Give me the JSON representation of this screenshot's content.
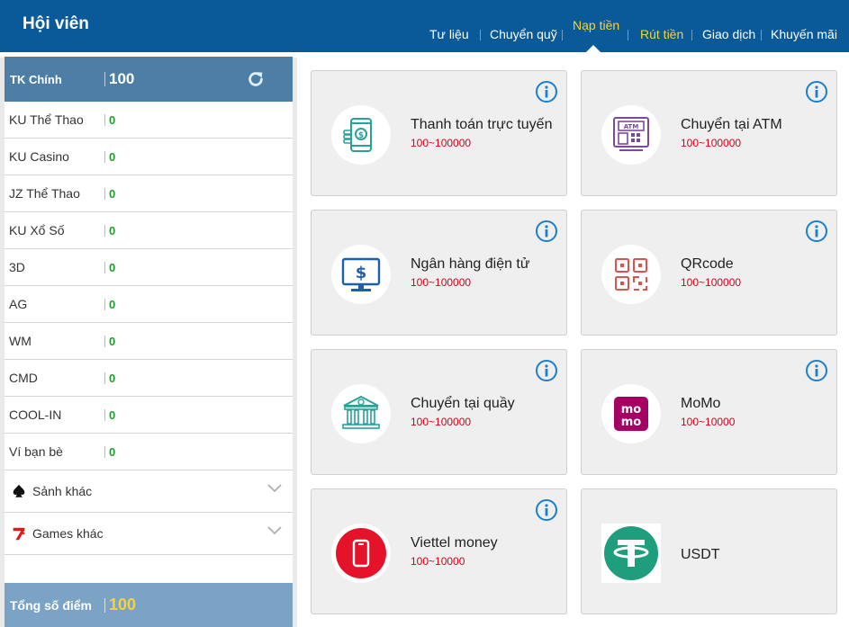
{
  "header": {
    "title": "Hội viên",
    "nav": [
      {
        "label": "Tư liệu"
      },
      {
        "label": "Chuyển quỹ"
      },
      {
        "label": "Nạp tiền"
      },
      {
        "label": "Rút tiền"
      },
      {
        "label": "Giao dịch"
      },
      {
        "label": "Khuyến mãi"
      }
    ],
    "active_tab": "Nạp tiền"
  },
  "sidebar": {
    "main_account": {
      "label": "TK Chính",
      "value": "100"
    },
    "accounts": [
      {
        "label": "KU Thể Thao",
        "value": "0"
      },
      {
        "label": "KU Casino",
        "value": "0"
      },
      {
        "label": "JZ Thể Thao",
        "value": "0"
      },
      {
        "label": "KU Xổ Số",
        "value": "0"
      },
      {
        "label": "3D",
        "value": "0"
      },
      {
        "label": "AG",
        "value": "0"
      },
      {
        "label": "WM",
        "value": "0"
      },
      {
        "label": "CMD",
        "value": "0"
      },
      {
        "label": "COOL-IN",
        "value": "0"
      },
      {
        "label": "Ví bạn bè",
        "value": "0"
      }
    ],
    "groups": [
      {
        "label": "Sảnh khác",
        "icon": "spade-icon"
      },
      {
        "label": "Games khác",
        "icon": "lucky-seven-icon"
      }
    ],
    "total": {
      "label": "Tổng số điểm",
      "value": "100"
    }
  },
  "methods": [
    {
      "title": "Thanh toán trực tuyến",
      "range": "100~100000",
      "icon": "mobile-payment-icon"
    },
    {
      "title": "Chuyển tại ATM",
      "range": "100~100000",
      "icon": "atm-icon"
    },
    {
      "title": "Ngân hàng điện tử",
      "range": "100~100000",
      "icon": "monitor-dollar-icon"
    },
    {
      "title": "QRcode",
      "range": "100~100000",
      "icon": "qrcode-icon"
    },
    {
      "title": "Chuyển tại quầy",
      "range": "100~100000",
      "icon": "bank-building-icon"
    },
    {
      "title": "MoMo",
      "range": "100~10000",
      "icon": "momo-logo"
    },
    {
      "title": "Viettel money",
      "range": "100~10000",
      "icon": "viettel-phone-icon"
    },
    {
      "title": "USDT",
      "range": "",
      "icon": "tether-logo"
    }
  ],
  "colors": {
    "header_bg": "#0a5a99",
    "active_tab": "#f6d23b",
    "balance_green": "#1e9e2a",
    "range_red": "#d0021b",
    "info_blue": "#1a7fd0"
  }
}
